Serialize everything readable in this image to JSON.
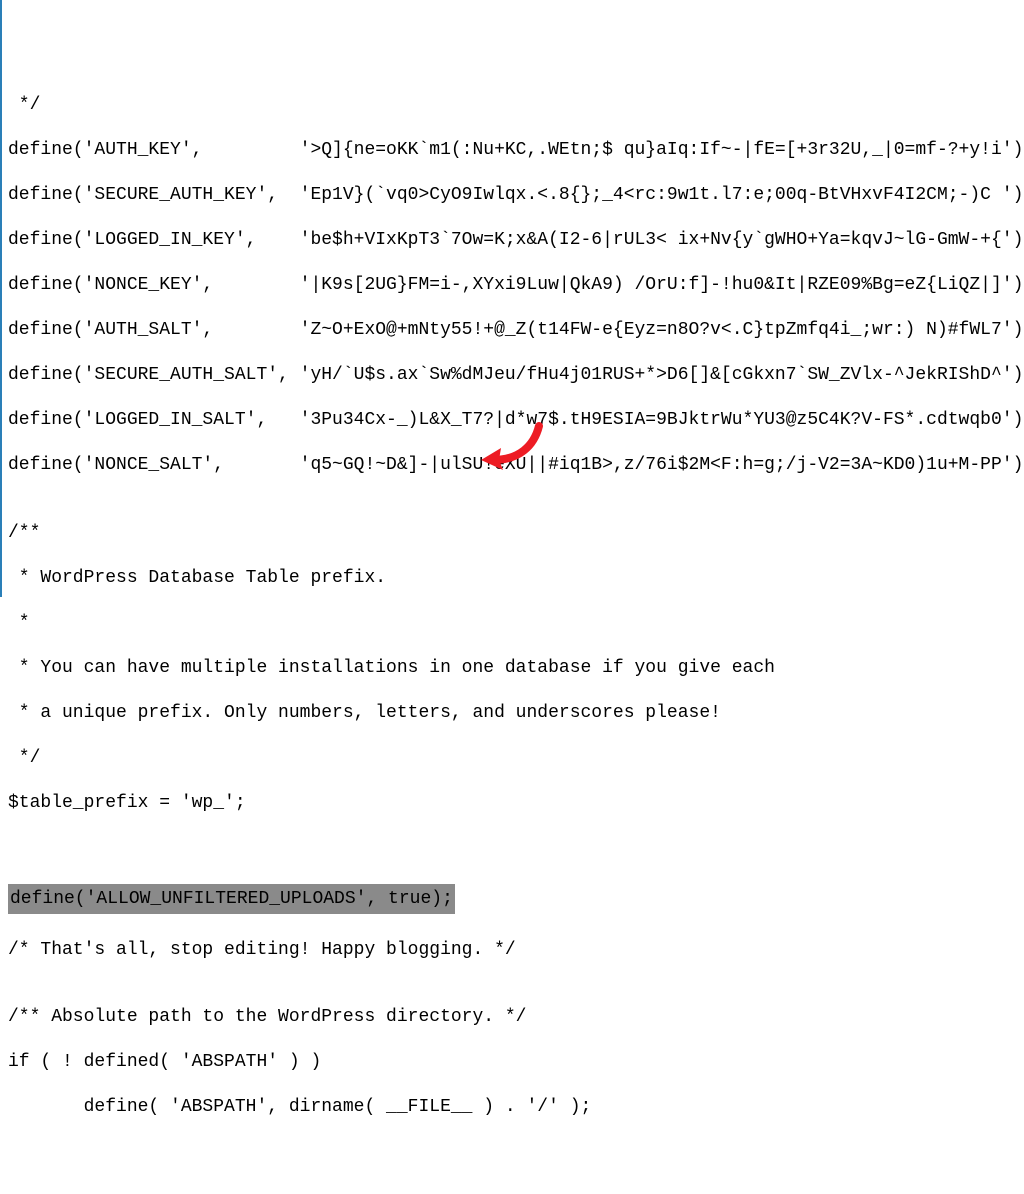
{
  "lines": {
    "l0": " */",
    "l1": "define('AUTH_KEY',         '>Q]{ne=oKK`m1(:Nu+KC,.WEtn;$ qu}aIq:If~-|fE=[+3r32U,_|0=mf-?+y!i');",
    "l2": "define('SECURE_AUTH_KEY',  'Ep1V}(`vq0>CyO9Iwlqx.<.8{};_4<rc:9w1t.l7:e;00q-BtVHxvF4I2CM;-)C ');",
    "l3": "define('LOGGED_IN_KEY',    'be$h+VIxKpT3`7Ow=K;x&A(I2-6|rUL3< ix+Nv{y`gWHO+Ya=kqvJ~lG-GmW-+{');",
    "l4": "define('NONCE_KEY',        '|K9s[2UG}FM=i-,XYxi9Luw|QkA9) /OrU:f]-!hu0&It|RZE09%Bg=eZ{LiQZ|]');",
    "l5": "define('AUTH_SALT',        'Z~O+ExO@+mNty55!+@_Z(t14FW-e{Eyz=n8O?v<.C}tpZmfq4i_;wr:) N)#fWL7');",
    "l6": "define('SECURE_AUTH_SALT', 'yH/`U$s.ax`Sw%dMJeu/fHu4j01RUS+*>D6[]&[cGkxn7`SW_ZVlx-^JekRIShD^');",
    "l7": "define('LOGGED_IN_SALT',   '3Pu34Cx-_)L&X_T7?|d*w7$.tH9ESIA=9BJktrWu*YU3@z5C4K?V-FS*.cdtwqb0');",
    "l8": "define('NONCE_SALT',       'q5~GQ!~D&]-|ulSU!eXU||#iq1B>,z/76i$2M<F:h=g;/j-V2=3A~KD0)1u+M-PP');",
    "l9": "",
    "l10": "/**",
    "l11": " * WordPress Database Table prefix.",
    "l12": " *",
    "l13": " * You can have multiple installations in one database if you give each",
    "l14": " * a unique prefix. Only numbers, letters, and underscores please!",
    "l15": " */",
    "l16": "$table_prefix = 'wp_';",
    "l17": "",
    "l18": "",
    "l19": "define('ALLOW_UNFILTERED_UPLOADS', true);",
    "l20": "",
    "l21": "/* That's all, stop editing! Happy blogging. */",
    "l22": "",
    "l23": "/** Absolute path to the WordPress directory. */",
    "l24": "if ( ! defined( 'ABSPATH' ) )",
    "l25": "       define( 'ABSPATH', dirname( __FILE__ ) . '/' );"
  }
}
